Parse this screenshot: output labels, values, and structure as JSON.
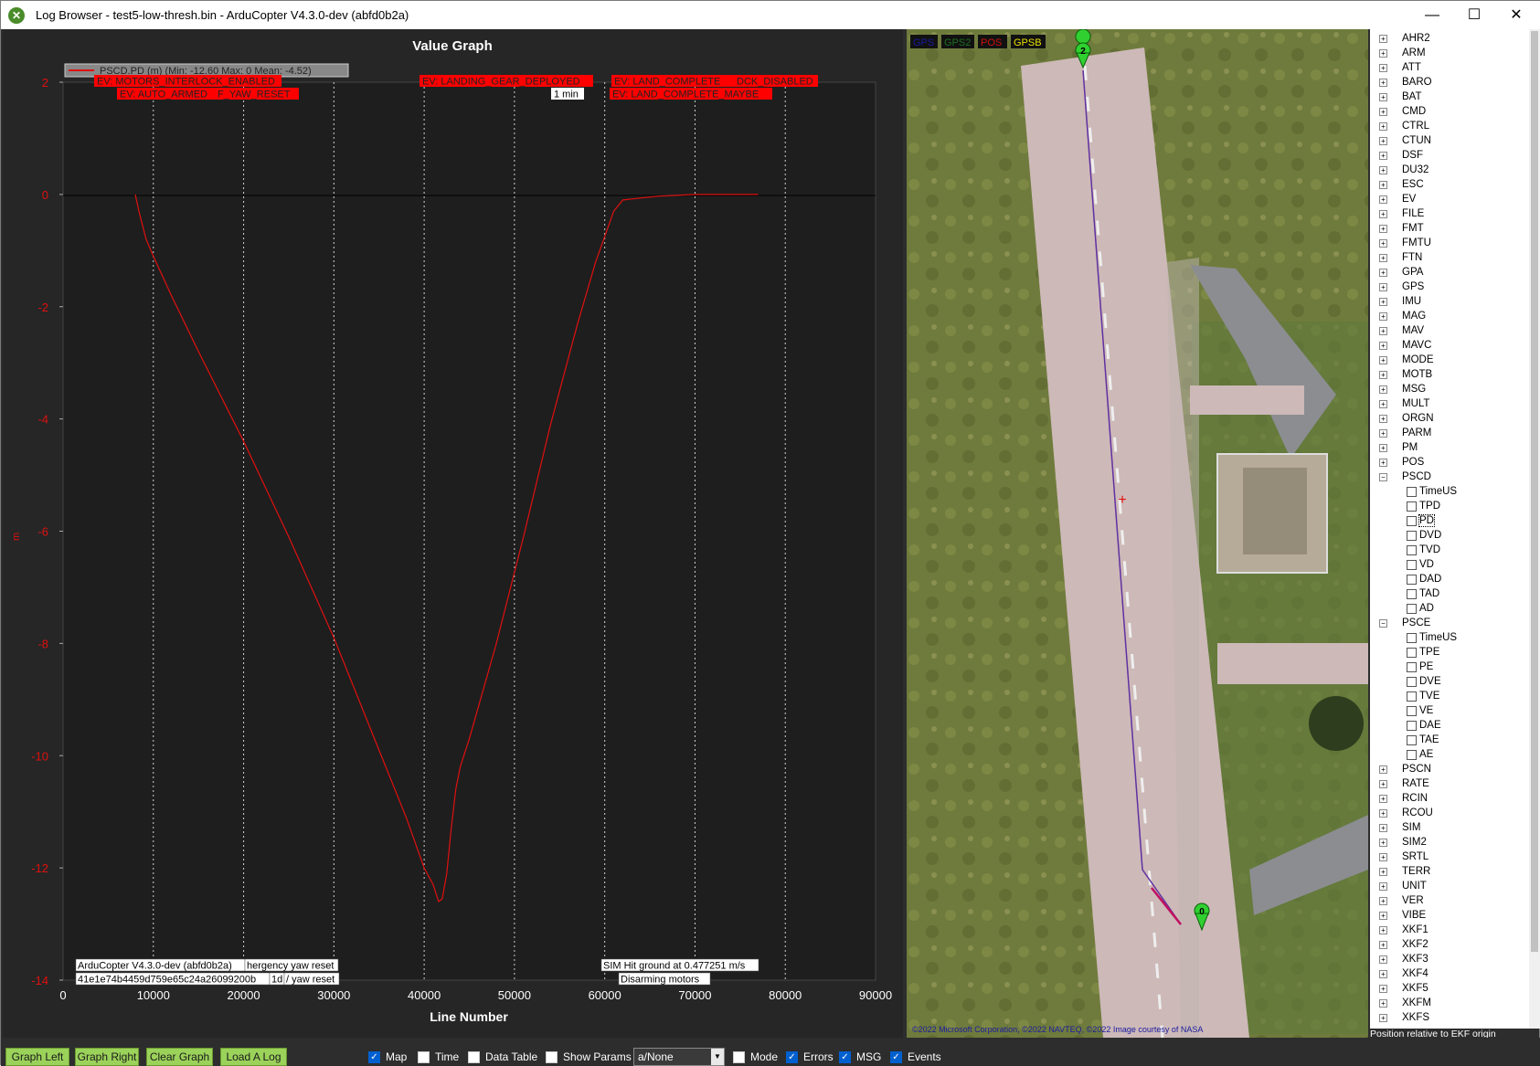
{
  "window": {
    "title": "Log Browser - test5-low-thresh.bin - ArduCopter V4.3.0-dev (abfd0b2a)",
    "minimize": "—",
    "maximize": "☐",
    "close": "✕"
  },
  "graph": {
    "title": "Value Graph",
    "legend_text": "PSCD.PD (m) (Min: -12.60 Max: 0 Mean: -4.52)",
    "ylabel": "m",
    "xlabel": "Line Number",
    "y_ticks": [
      "2",
      "0",
      "-2",
      "-4",
      "-6",
      "-8",
      "-10",
      "-12",
      "-14"
    ],
    "x_ticks": [
      "0",
      "10000",
      "20000",
      "30000",
      "40000",
      "50000",
      "60000",
      "70000",
      "80000",
      "90000"
    ],
    "event_labels": [
      "EV: MOTORS_INTERLOCK_ENABLED",
      "EV: AUTO_ARMED",
      "F_YAW_RESET",
      "EV: LANDING_GEAR_DEPLOYED",
      "1 min",
      "EV: LAND_COMPLETE",
      "DCK_DISABLED",
      "EV: LAND_COMPLETE_MAYBE"
    ],
    "msg_labels": [
      "ArduCopter V4.3.0-dev (abfd0b2a)",
      "hergency yaw reset",
      "41e1e74b4459d759e65c24a26099200b",
      "1d",
      "/ yaw reset",
      "SIM Hit ground at 0.477251 m/s",
      "Disarming motors"
    ],
    "line_color": "#e01010"
  },
  "chart_data": {
    "type": "line",
    "title": "Value Graph",
    "xlabel": "Line Number",
    "ylabel": "m",
    "xlim": [
      0,
      90000
    ],
    "ylim": [
      -14,
      2
    ],
    "grid": true,
    "series": [
      {
        "name": "PSCD.PD (m)",
        "x": [
          8000,
          8400,
          8800,
          9200,
          10000,
          12000,
          15000,
          20000,
          25000,
          30000,
          35000,
          38000,
          40000,
          41000,
          41600,
          42000,
          42500,
          43000,
          43500,
          44000,
          45000,
          48000,
          51000,
          54000,
          57000,
          59000,
          61000,
          62000,
          63000,
          66000,
          70000,
          77000
        ],
        "y": [
          0,
          -0.3,
          -0.55,
          -0.8,
          -1.1,
          -1.8,
          -2.8,
          -4.4,
          -6.1,
          -7.9,
          -9.9,
          -11.1,
          -12.0,
          -12.3,
          -12.6,
          -12.55,
          -12.1,
          -11.3,
          -10.6,
          -10.2,
          -9.7,
          -8.0,
          -6.1,
          -4.1,
          -2.3,
          -1.2,
          -0.3,
          -0.1,
          -0.08,
          -0.03,
          0,
          0
        ]
      }
    ]
  },
  "map": {
    "legend": [
      {
        "label": "GPS",
        "color": "#1a1aa0"
      },
      {
        "label": "GPS2",
        "color": "#1f6f1f"
      },
      {
        "label": "POS",
        "color": "#d01010"
      },
      {
        "label": "GPSB",
        "color": "#e8e000"
      }
    ],
    "marker_start": "2",
    "marker_end": "0",
    "copyright": "©2022 Microsoft Corporation, ©2022 NAVTEQ, ©2022 Image courtesy of NASA"
  },
  "tree": {
    "top_items": [
      "AHR2",
      "ARM",
      "ATT",
      "BARO",
      "BAT",
      "CMD",
      "CTRL",
      "CTUN",
      "DSF",
      "DU32",
      "ESC",
      "EV",
      "FILE",
      "FMT",
      "FMTU",
      "FTN",
      "GPA",
      "GPS",
      "IMU",
      "MAG",
      "MAV",
      "MAVC",
      "MODE",
      "MOTB",
      "MSG",
      "MULT",
      "ORGN",
      "PARM",
      "PM",
      "POS"
    ],
    "pscd": {
      "label": "PSCD",
      "children": [
        "TimeUS",
        "TPD",
        "PD",
        "DVD",
        "TVD",
        "VD",
        "DAD",
        "TAD",
        "AD"
      ]
    },
    "psce": {
      "label": "PSCE",
      "children": [
        "TimeUS",
        "TPE",
        "PE",
        "DVE",
        "TVE",
        "VE",
        "DAE",
        "TAE",
        "AE"
      ]
    },
    "bottom_items": [
      "PSCN",
      "RATE",
      "RCIN",
      "RCOU",
      "SIM",
      "SIM2",
      "SRTL",
      "TERR",
      "UNIT",
      "VER",
      "VIBE",
      "XKF1",
      "XKF2",
      "XKF3",
      "XKF4",
      "XKF5",
      "XKFM",
      "XKFS"
    ],
    "status": "Position relative to EKF origin"
  },
  "toolbar": {
    "graph_left": "Graph Left",
    "graph_right": "Graph Right",
    "clear_graph": "Clear Graph",
    "load_log": "Load A Log",
    "map": "Map",
    "time": "Time",
    "data_table": "Data Table",
    "show_params": "Show Params",
    "dropdown_value": "a/None",
    "mode": "Mode",
    "errors": "Errors",
    "msg": "MSG",
    "events": "Events"
  }
}
